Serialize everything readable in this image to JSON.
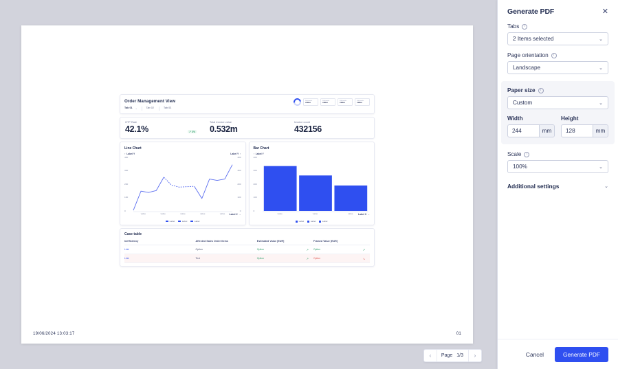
{
  "panel": {
    "title": "Generate PDF",
    "close_icon": "close-icon",
    "fields": {
      "tabs": {
        "label": "Tabs",
        "value": "2 Items selected"
      },
      "orientation": {
        "label": "Page orientation",
        "value": "Landscape"
      },
      "paper_size": {
        "label": "Paper size",
        "value": "Custom"
      },
      "width": {
        "label": "Width",
        "value": "244",
        "unit": "mm"
      },
      "height": {
        "label": "Height",
        "value": "128",
        "unit": "mm"
      },
      "scale": {
        "label": "Scale",
        "value": "100%"
      }
    },
    "additional_settings": {
      "label": "Additional settings"
    },
    "footer": {
      "cancel": "Cancel",
      "generate": "Generate PDF"
    },
    "accent_color": "#2f4ff0",
    "group_bg": "#f4f5f9"
  },
  "preview": {
    "pagination": {
      "prev": "‹",
      "next": "›",
      "label": "Page",
      "count": "1/3"
    },
    "footer": {
      "timestamp": "19/06/2024  13:03:17",
      "page_number": "01"
    }
  },
  "dashboard": {
    "title": "Order Management View",
    "tabs": [
      "Tab 01",
      "Tab 02",
      "Tab 03"
    ],
    "badges": [
      {
        "top": "Subheader",
        "bottom": "value"
      },
      {
        "top": "Subheader",
        "bottom": "value"
      },
      {
        "top": "Subheader",
        "bottom": "value"
      },
      {
        "top": "Subheader",
        "bottom": "value"
      }
    ],
    "kpis": [
      {
        "label": "OTP Rate",
        "value": "42.1%",
        "trend": "3%",
        "trend_dir": "up"
      },
      {
        "label": "Total invoice value",
        "value": "0.532m"
      },
      {
        "label": "Invoice count",
        "value": "432156"
      }
    ],
    "case_table": {
      "title": "Case table",
      "columns": [
        "Inefficiency",
        "Affected Sales Order Items",
        "Estimated Value [EUR]",
        "Framed Value [EUR]"
      ],
      "rows": [
        {
          "c0": "Link",
          "c1": "Option",
          "c2": "Option",
          "c2_dir": "up",
          "c3": "Option",
          "c3_dir": "up",
          "c3_color": "green"
        },
        {
          "c0": "Link",
          "c1": "Text",
          "c2": "Option",
          "c2_dir": "up",
          "c3": "Option",
          "c3_dir": "down",
          "c3_color": "red"
        }
      ]
    }
  },
  "chart_data": [
    {
      "type": "line",
      "title": "Line Chart",
      "ylabel": "Label Y",
      "ylabel_right": "Label Y",
      "xlabel": "Label X",
      "ylim": [
        0,
        400
      ],
      "yticks": [
        0,
        100,
        200,
        300,
        400
      ],
      "yticks_right": [
        0,
        100,
        200,
        300,
        400
      ],
      "xticks": [
        "value",
        "value",
        "value",
        "value",
        "value"
      ],
      "grid": false,
      "legend_position": "bottom",
      "legend": [
        "Label",
        "Label",
        "Label"
      ],
      "x": [
        0,
        1,
        2,
        3,
        4,
        5,
        6,
        7,
        8,
        9,
        10,
        11
      ],
      "series": [
        {
          "name": "Label",
          "values": [
            5,
            148,
            138,
            152,
            252,
            193,
            178,
            181,
            184,
            93,
            238,
            228,
            238,
            345
          ]
        }
      ],
      "color": "#5b6ef0"
    },
    {
      "type": "bar",
      "title": "Bar Chart",
      "ylabel": "Label Y",
      "xlabel": "Label X",
      "ylim": [
        0,
        400
      ],
      "yticks": [
        0,
        100,
        200,
        300,
        400
      ],
      "categories": [
        "value",
        "value",
        "value"
      ],
      "values": [
        335,
        265,
        190
      ],
      "grid": false,
      "legend_position": "bottom",
      "legend": [
        "Label",
        "Label",
        "Label"
      ],
      "color": "#2f4ff0"
    }
  ]
}
